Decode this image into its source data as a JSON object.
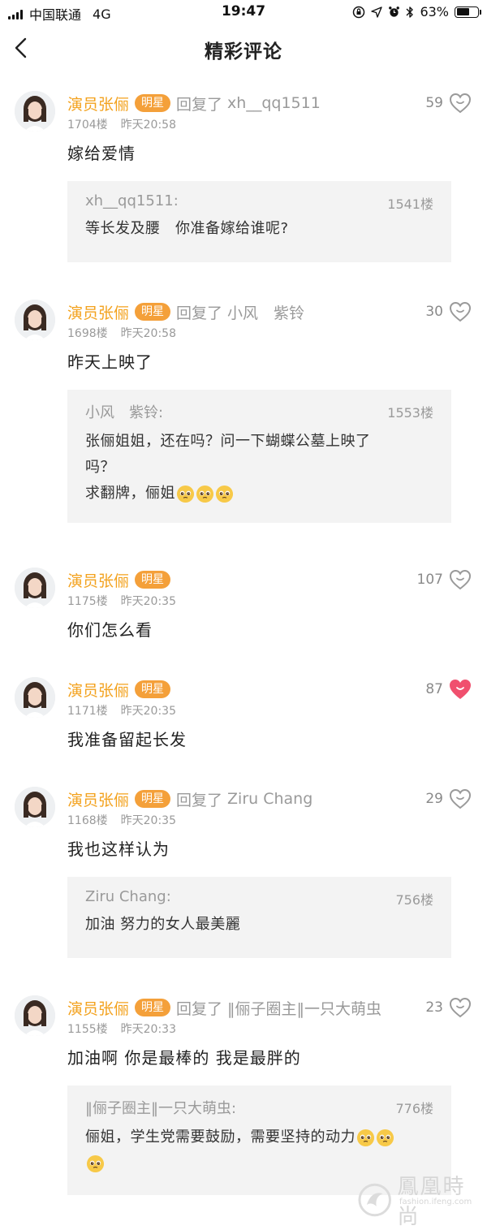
{
  "status_bar": {
    "carrier": "中国联通",
    "network": "4G",
    "time": "19:47",
    "battery": "63%",
    "battery_level": 0.63
  },
  "nav": {
    "title": "精彩评论"
  },
  "comments": [
    {
      "user": "演员张俪",
      "badge": "明星",
      "reply_word": "回复了",
      "reply_to": "xh__qq1511",
      "likes": "59",
      "liked": false,
      "floor": "1704楼",
      "time": "昨天20:58",
      "text": "嫁给爱情",
      "quote": {
        "user": "xh__qq1511:",
        "floor": "1541楼",
        "lines": [
          "等长发及腰　你准备嫁给谁呢?"
        ]
      }
    },
    {
      "user": "演员张俪",
      "badge": "明星",
      "reply_word": "回复了",
      "reply_to": "小风　紫铃",
      "likes": "30",
      "liked": false,
      "floor": "1698楼",
      "time": "昨天20:58",
      "text": "昨天上映了",
      "quote": {
        "user": "小风　紫铃:",
        "floor": "1553楼",
        "lines": [
          "张俪姐姐，还在吗？问一下蝴蝶公墓上映了",
          "吗？",
          "求翻牌，俪姐"
        ]
      }
    },
    {
      "user": "演员张俪",
      "badge": "明星",
      "likes": "107",
      "liked": false,
      "floor": "1175楼",
      "time": "昨天20:35",
      "text": "你们怎么看"
    },
    {
      "user": "演员张俪",
      "badge": "明星",
      "likes": "87",
      "liked": true,
      "floor": "1171楼",
      "time": "昨天20:35",
      "text": "我准备留起长发"
    },
    {
      "user": "演员张俪",
      "badge": "明星",
      "reply_word": "回复了",
      "reply_to": "Ziru Chang",
      "likes": "29",
      "liked": false,
      "floor": "1168楼",
      "time": "昨天20:35",
      "text": "我也这样认为",
      "quote": {
        "user": "Ziru Chang:",
        "floor": "756楼",
        "lines": [
          "加油 努力的女人最美麗"
        ]
      }
    },
    {
      "user": "演员张俪",
      "badge": "明星",
      "reply_word": "回复了",
      "reply_to": "‖俪子圈主‖一只大萌虫",
      "likes": "23",
      "liked": false,
      "floor": "1155楼",
      "time": "昨天20:33",
      "text": "加油啊 你是最棒的 我是最胖的",
      "quote": {
        "user": "‖俪子圈主‖一只大萌虫:",
        "floor": "776楼",
        "lines": [
          "俪姐，学生党需要鼓励，需要坚持的动力",
          ""
        ]
      }
    }
  ],
  "watermark": {
    "text": "鳳凰時尚",
    "sub": "fashion.ifeng.com"
  },
  "colors": {
    "accent": "#f3a21e",
    "badge": "#f4a03a",
    "liked_heart": "#f0506e",
    "quote_bg": "#f3f3f3"
  },
  "icons": {
    "back": "chevron-left-icon",
    "like": "heart-outline-icon",
    "liked": "heart-filled-icon",
    "emoji": "pleading-face-emoji"
  }
}
